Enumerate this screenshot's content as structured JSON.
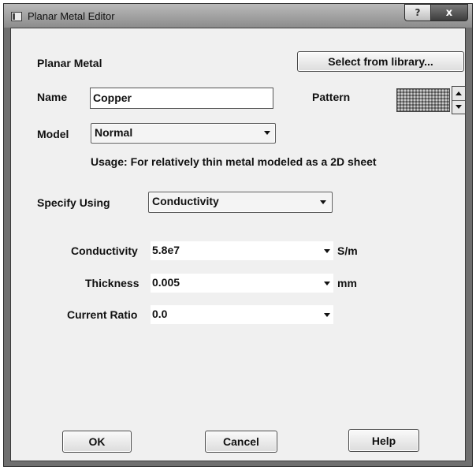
{
  "window": {
    "title": "Planar Metal Editor",
    "help_glyph": "?",
    "close_glyph": "x"
  },
  "header": {
    "section_label": "Planar Metal",
    "library_button": "Select from library..."
  },
  "name": {
    "label": "Name",
    "value": "Copper"
  },
  "pattern": {
    "label": "Pattern"
  },
  "model": {
    "label": "Model",
    "value": "Normal",
    "usage": "Usage: For relatively thin metal modeled as a 2D sheet"
  },
  "specify": {
    "label": "Specify Using",
    "value": "Conductivity"
  },
  "conductivity": {
    "label": "Conductivity",
    "value": "5.8e7",
    "unit": "S/m"
  },
  "thickness": {
    "label": "Thickness",
    "value": "0.005",
    "unit": "mm"
  },
  "current_ratio": {
    "label": "Current Ratio",
    "value": "0.0"
  },
  "buttons": {
    "ok": "OK",
    "cancel": "Cancel",
    "help": "Help"
  },
  "icons": {
    "app": "dialog-app-icon",
    "title_help": "question-icon",
    "title_close": "close-icon",
    "dropdown": "chevron-down-icon",
    "spin_up": "spin-up-icon",
    "spin_down": "spin-down-icon"
  },
  "colors": {
    "dialog_background": "#f0f0f0",
    "titlebar": "#9a9a9a",
    "frame": "#6f6f6f",
    "close_button": "#4a4a4a"
  }
}
